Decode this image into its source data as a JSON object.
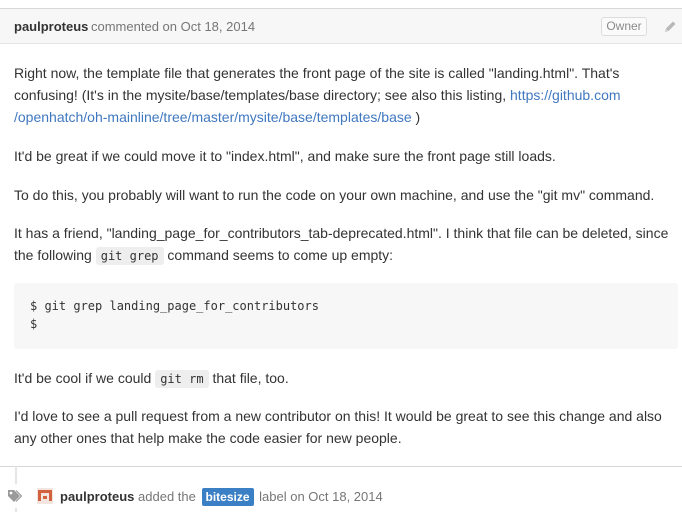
{
  "comment": {
    "author": "paulproteus",
    "meta": "commented on Oct 18, 2014",
    "owner_badge": "Owner",
    "p1_text": "Right now, the template file that generates the front page of the site is called \"landing.html\". That's confusing! (It's in the mysite/base/templates/base directory; see also this listing, ",
    "p1_link": "https://github.com/openhatch/oh-mainline/tree/master/mysite/base/templates/base",
    "p1_link_line1": "https://github.com",
    "p1_link_line2": "/openhatch/oh-mainline/tree/master/mysite/base/templates/base",
    "p1_end": " )",
    "p2": "It'd be great if we could move it to \"index.html\", and make sure the front page still loads.",
    "p3": "To do this, you probably will want to run the code on your own machine, and use the \"git mv\" command.",
    "p4_a": "It has a friend, \"landing_page_for_contributors_tab-deprecated.html\". I think that file can be deleted, since the following ",
    "p4_code": "git grep",
    "p4_b": " command seems to come up empty:",
    "code_lines": [
      "$ git grep landing_page_for_contributors",
      "$"
    ],
    "p5_a": "It'd be cool if we could ",
    "p5_code": "git rm",
    "p5_b": " that file, too.",
    "p6": "I'd love to see a pull request from a new contributor on this! It would be great to see this change and also any other ones that help make the code easier for new people."
  },
  "event": {
    "icon": "tag-icon",
    "actor": "paulproteus",
    "action": "added the",
    "label": "bitesize",
    "label_color": "#3b7fc4",
    "suffix": "label on Oct 18, 2014"
  }
}
